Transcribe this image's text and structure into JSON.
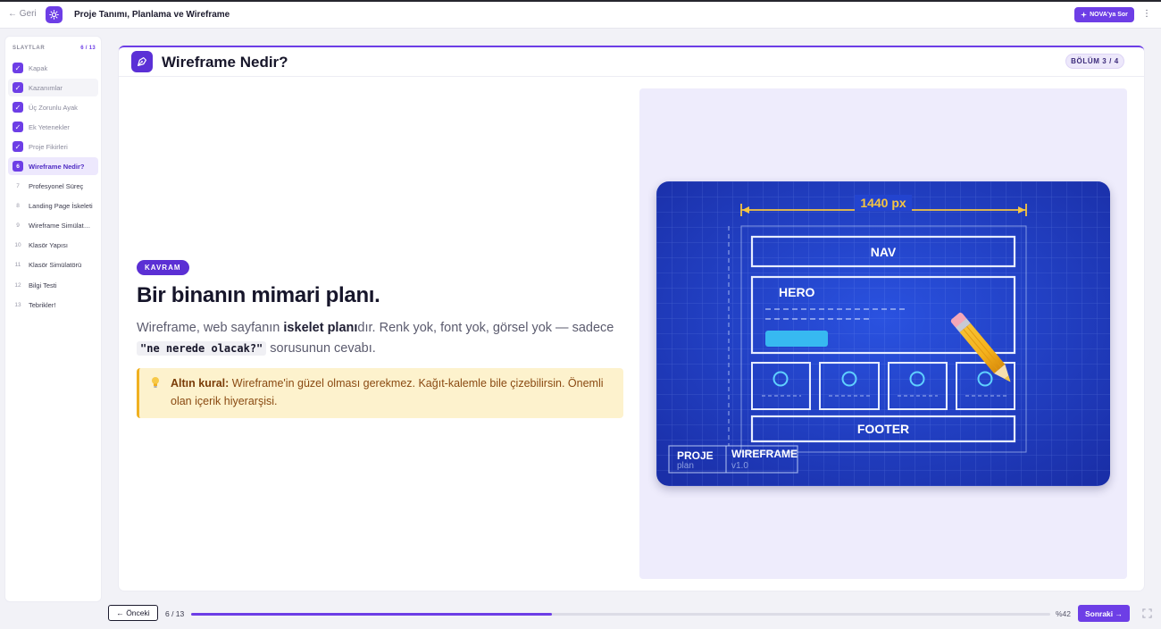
{
  "header": {
    "back_label": "← Geri",
    "title": "Proje Tanımı, Planlama ve Wireframe",
    "nova_label": "NOVA'ya Sor",
    "more_label": "⋮"
  },
  "sidebar": {
    "heading": "SLAYTLAR",
    "counter": "6 / 13",
    "items": [
      {
        "number": "1",
        "label": "Kapak",
        "state": "done"
      },
      {
        "number": "2",
        "label": "Kazanımlar",
        "state": "done"
      },
      {
        "number": "3",
        "label": "Üç Zorunlu Ayak",
        "state": "done"
      },
      {
        "number": "4",
        "label": "Ek Yetenekler",
        "state": "done"
      },
      {
        "number": "5",
        "label": "Proje Fikirleri",
        "state": "done"
      },
      {
        "number": "6",
        "label": "Wireframe Nedir?",
        "state": "active"
      },
      {
        "number": "7",
        "label": "Profesyonel Süreç",
        "state": "todo"
      },
      {
        "number": "8",
        "label": "Landing Page İskeleti",
        "state": "todo"
      },
      {
        "number": "9",
        "label": "Wireframe Simülatörü",
        "state": "todo"
      },
      {
        "number": "10",
        "label": "Klasör Yapısı",
        "state": "todo"
      },
      {
        "number": "11",
        "label": "Klasör Simülatörü",
        "state": "todo"
      },
      {
        "number": "12",
        "label": "Bilgi Testi",
        "state": "todo"
      },
      {
        "number": "13",
        "label": "Tebrikler!",
        "state": "todo"
      }
    ]
  },
  "slide": {
    "title": "Wireframe Nedir?",
    "section_badge": "BÖLÜM 3 / 4",
    "tag": "KAVRAM",
    "heading": "Bir binanın mimari planı.",
    "para_part1": "Wireframe, web sayfanın ",
    "para_bold": "iskelet planı",
    "para_part2": "dır. Renk yok, font yok, görsel yok — sadece ",
    "para_code": "\"ne nerede olacak?\"",
    "para_part3": " sorusunun cevabı.",
    "rule_bold": "Altın kural:",
    "rule_text": " Wireframe'in güzel olması gerekmez. Kağıt-kalemle bile çizebilirsin. Önemli olan içerik hiyerarşisi."
  },
  "blueprint": {
    "width_label": "1440 px",
    "nav_label": "NAV",
    "hero_label": "HERO",
    "footer_label": "FOOTER",
    "stamp_project": "PROJE",
    "stamp_project_sub": "plan",
    "stamp_wireframe": "WIREFRAME",
    "stamp_version": "v1.0"
  },
  "footer": {
    "prev_label": "← Önceki",
    "position": "6 / 13",
    "progress_percent": 42,
    "percent_label": "%42",
    "next_label": "Sonraki →"
  },
  "colors": {
    "accent": "#6d3ee6",
    "blueprint": "#1f3fc4",
    "highlight": "#fdf2cd",
    "pencil": "#f5b622"
  }
}
